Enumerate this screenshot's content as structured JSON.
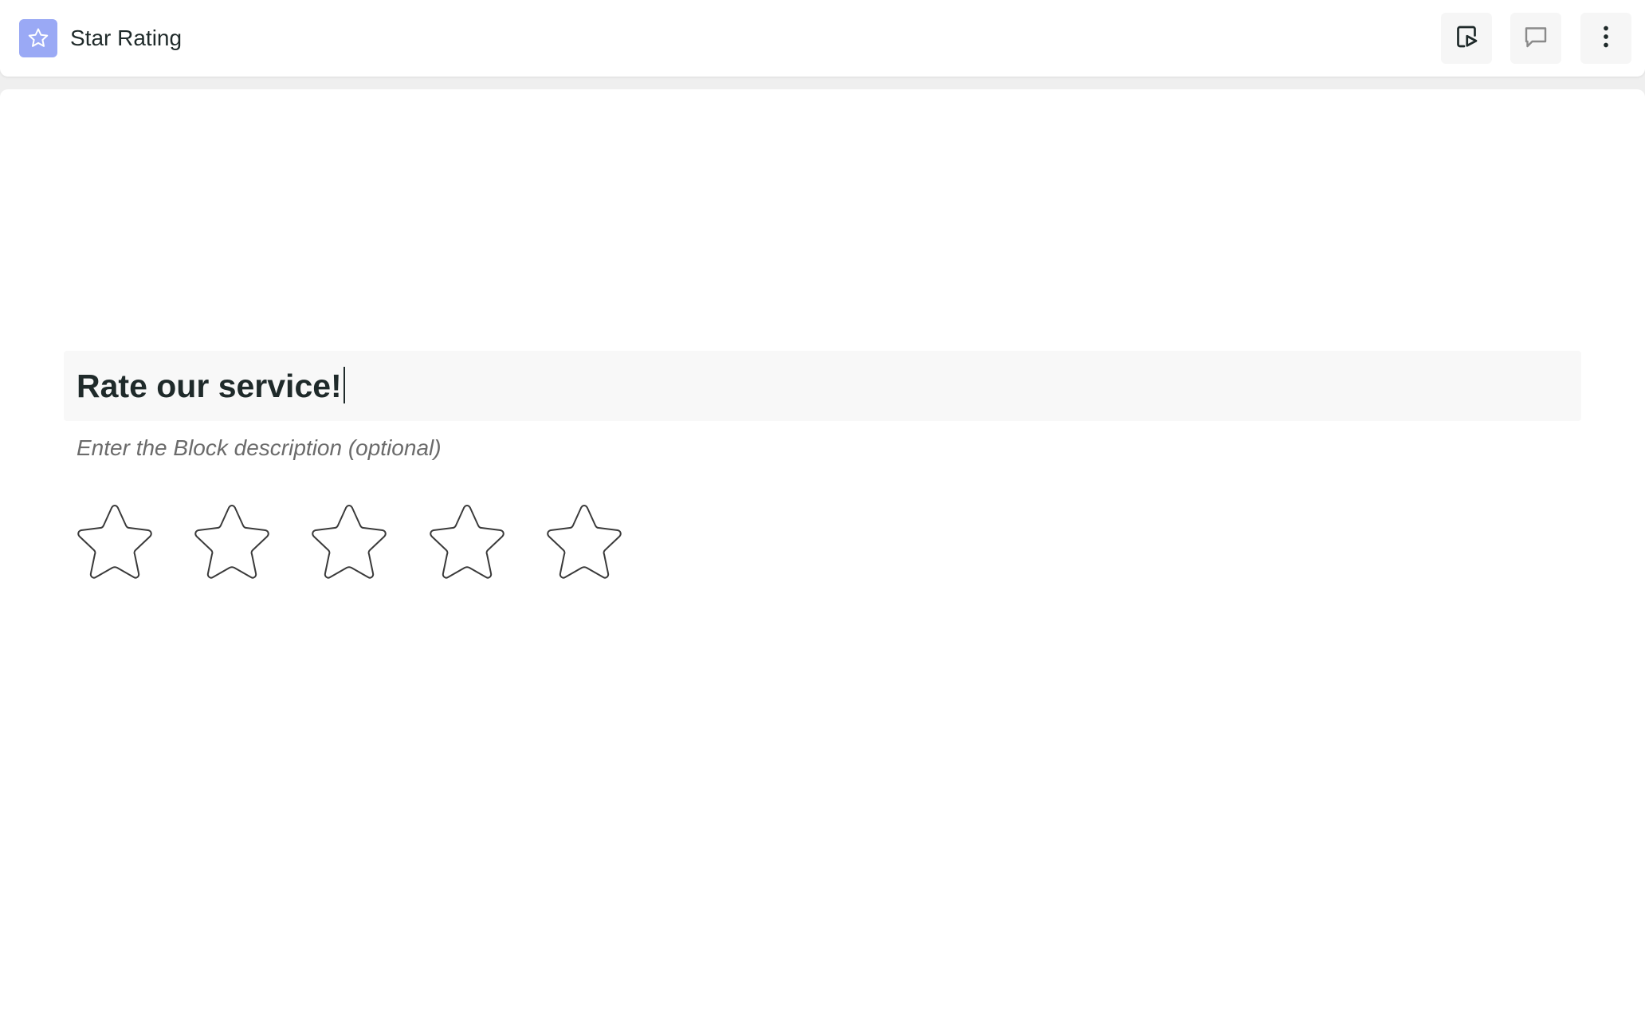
{
  "header": {
    "title": "Star Rating",
    "icon": "star-icon",
    "actions": [
      {
        "name": "preview",
        "icon": "preview-play-icon"
      },
      {
        "name": "comment",
        "icon": "comment-icon"
      },
      {
        "name": "more",
        "icon": "more-vertical-icon"
      }
    ]
  },
  "block": {
    "question": "Rate our service!",
    "description_placeholder": "Enter the Block description (optional)",
    "rating": {
      "max_stars": 5,
      "selected": 0
    }
  },
  "colors": {
    "accent": "#9aa9f5",
    "text": "#1f2a2a",
    "muted_text": "#6b6b6b",
    "background": "#efefef"
  }
}
